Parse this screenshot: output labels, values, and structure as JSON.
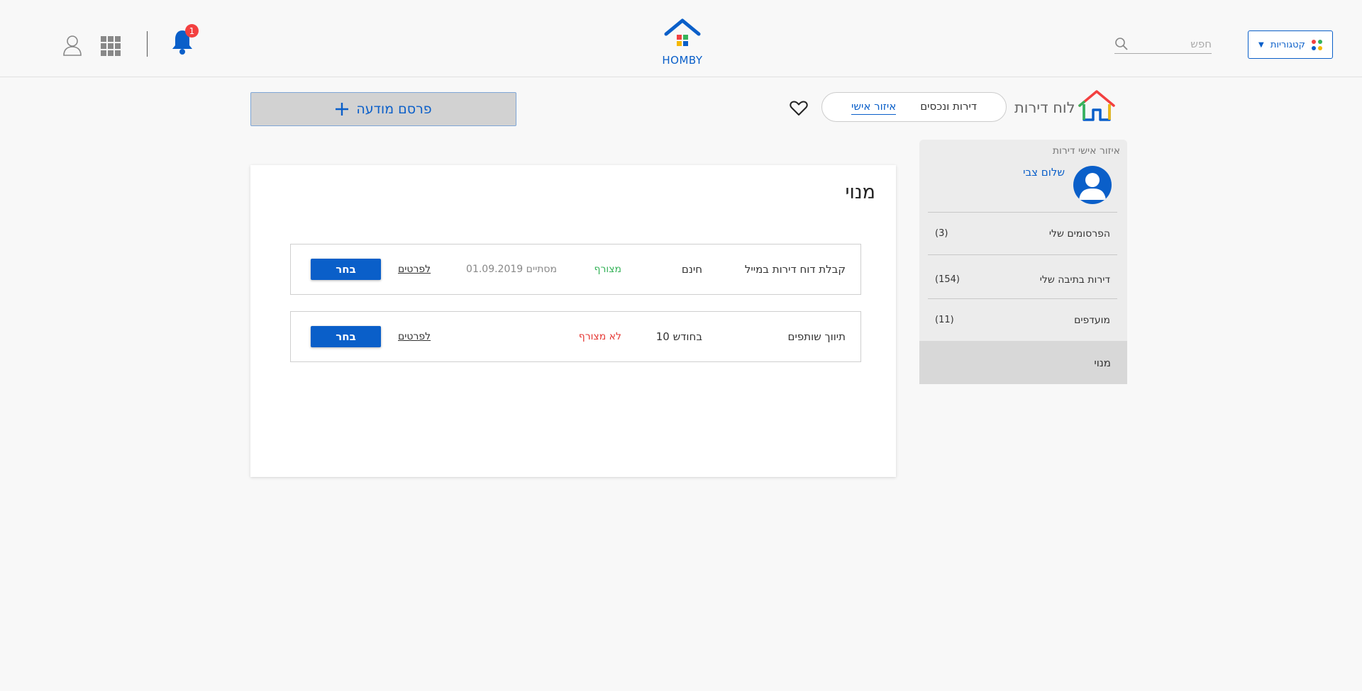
{
  "header": {
    "categories_label": "קטגוריות",
    "search_placeholder": "חפש",
    "brand": "HOMBY",
    "notifications_count": "1",
    "colors": {
      "accent": "#0a5fc9",
      "badge": "#f34040"
    }
  },
  "subbar": {
    "board_title": "לוח דירות",
    "tabs": [
      {
        "label": "דירות ונכסים"
      },
      {
        "label": "איזור אישי"
      }
    ],
    "publish_label": "פרסם מודעה"
  },
  "sidebar": {
    "title": "איזור אישי דירות",
    "username": "שלום צבי",
    "items": [
      {
        "label": "הפרסומים שלי",
        "count": "(3)"
      },
      {
        "label": "דירות בתיבה שלי",
        "count": "(154)"
      },
      {
        "label": "מועדפים",
        "count": "(11)"
      }
    ],
    "active_item": "מנוי"
  },
  "main": {
    "title": "מנוי",
    "rows": [
      {
        "name": "קבלת דוח דירות במייל",
        "price": "חינם",
        "status": "מצורף",
        "end": "מסתיים 01.09.2019",
        "details_link": "לפרטים",
        "select_label": "בחר"
      },
      {
        "name": "תיווך שותפים",
        "price": "בחודש 10",
        "status": "לא מצורף",
        "end": "",
        "details_link": "לפרטים",
        "select_label": "בחר"
      }
    ]
  }
}
